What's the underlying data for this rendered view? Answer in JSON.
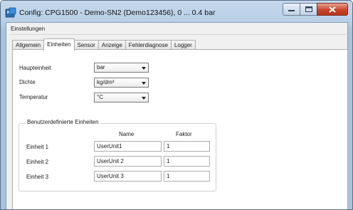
{
  "window": {
    "title": "Config: CPG1500 - Demo-SN2 (Demo123456), 0 ... 0.4 bar"
  },
  "settings_group": {
    "label": "Einstellungen"
  },
  "tabs": [
    {
      "label": "Allgemein",
      "active": false
    },
    {
      "label": "Einheiten",
      "active": true
    },
    {
      "label": "Sensor",
      "active": false
    },
    {
      "label": "Anzeige",
      "active": false
    },
    {
      "label": "Fehlerdiagnose",
      "active": false
    },
    {
      "label": "Logger",
      "active": false
    }
  ],
  "units": {
    "main_unit": {
      "label": "Haupteinheit",
      "value": "bar"
    },
    "density": {
      "label": "Dichte",
      "value": "kg/dm³"
    },
    "temperature": {
      "label": "Temperatur",
      "value": "°C"
    }
  },
  "user_units": {
    "legend": "Benutzerdefinierte Einheiten",
    "col_name": "Name",
    "col_factor": "Faktor",
    "rows": [
      {
        "label": "Einheit 1",
        "name": "UserUnit1",
        "factor": "1"
      },
      {
        "label": "Einheit 2",
        "name": "UserUnit 2",
        "factor": "1"
      },
      {
        "label": "Einheit 3",
        "name": "UserUnit 3",
        "factor": "1"
      }
    ]
  },
  "colors": {
    "title_bar": "#b9cfe7",
    "close_button": "#c9452c",
    "panel_bg": "#ffffff",
    "client_bg": "#f0f0f0"
  },
  "icons": {
    "app": "app-config-icon",
    "minimize": "minimize-icon",
    "maximize": "maximize-icon",
    "close": "close-icon"
  }
}
